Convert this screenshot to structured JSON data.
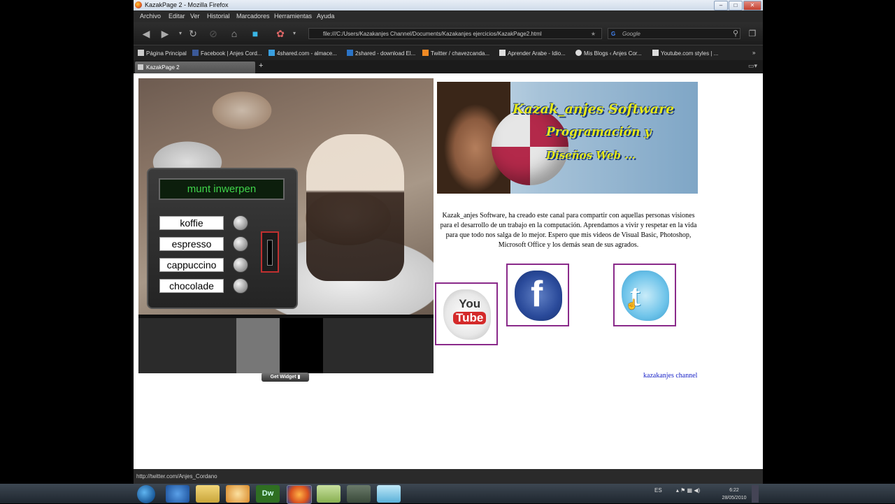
{
  "window": {
    "title": "KazakPage 2 - Mozilla Firefox",
    "controls": [
      "–",
      "□",
      "✕"
    ]
  },
  "menu": [
    "Archivo",
    "Editar",
    "Ver",
    "Historial",
    "Marcadores",
    "Herramientas",
    "Ayuda"
  ],
  "navigation": {
    "url": "file:///C:/Users/Kazakanjes Channel/Documents/Kazakanjes ejercicios/KazakPage2.html",
    "search_placeholder": "Google"
  },
  "bookmarks": [
    {
      "label": "Página Principal",
      "icon": "page-icon",
      "color": "#cccccc"
    },
    {
      "label": "Facebook | Anjes Cord...",
      "icon": "facebook-icon",
      "color": "#3b5998"
    },
    {
      "label": "4shared.com - almace...",
      "icon": "4shared-icon",
      "color": "#3aa0e0"
    },
    {
      "label": "2shared - download El...",
      "icon": "2shared-icon",
      "color": "#2b74c7"
    },
    {
      "label": "Twitter / chavezcanda...",
      "icon": "rss-icon",
      "color": "#f08a24"
    },
    {
      "label": "Aprender Arabe - Idio...",
      "icon": "page-icon",
      "color": "#dddddd"
    },
    {
      "label": "Mis Blogs ‹ Anjes Cor...",
      "icon": "wordpress-icon",
      "color": "#dddddd"
    },
    {
      "label": "Youtube.com styles | ...",
      "icon": "page-icon",
      "color": "#dddddd"
    }
  ],
  "tab": {
    "label": "KazakPage 2",
    "new_tab": "+"
  },
  "widget": {
    "display": "munt inwerpen",
    "drinks": [
      "koffie",
      "espresso",
      "cappuccino",
      "chocolade"
    ],
    "get_widget": "Get Widget"
  },
  "banner": {
    "line1": "Kazak_anjes Software",
    "line2": "Programación y",
    "line3": "Diseños Web ..."
  },
  "description": "Kazak_anjes Software, ha creado este canal para compartir con aquellas personas visiones para el desarrollo de un trabajo en la computación. Aprendamos a vivir y respetar en la vida para que todo nos salga de lo mejor. Espero que mis videos de Visual Basic, Photoshop, Microsoft Office y los demás sean de sus agrados.",
  "social": {
    "youtube_top": "You",
    "youtube_bottom": "Tube",
    "facebook": "f",
    "twitter": "t"
  },
  "channel_link": "kazakanjes channel",
  "status": "http://twitter.com/Anjes_Cordano",
  "taskbar": {
    "lang": "ES",
    "time": "6:22",
    "date": "28/05/2010"
  },
  "colors": {
    "lcd_text": "#3fd34a",
    "link": "#1a24c8",
    "social_border": "#8a2a8a",
    "slot_border": "#c03030"
  }
}
